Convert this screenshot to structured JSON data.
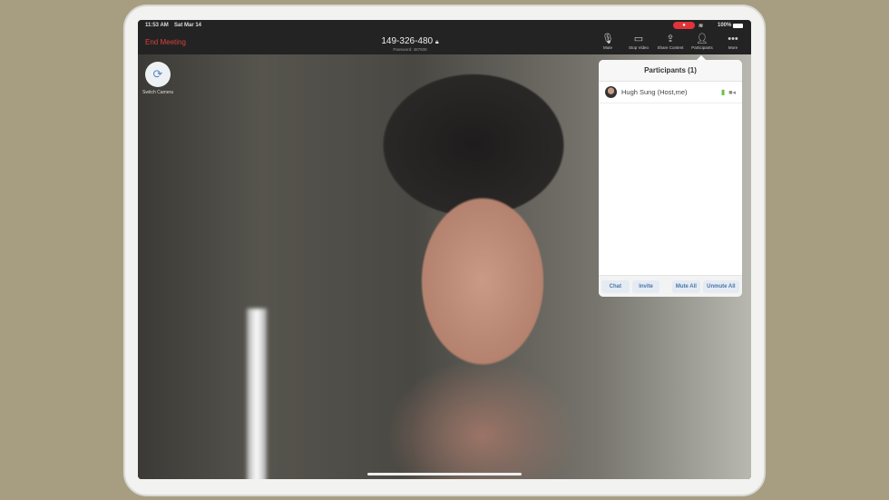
{
  "status": {
    "time": "11:53 AM",
    "date": "Sat Mar 14",
    "battery": "100%"
  },
  "meeting": {
    "end_label": "End Meeting",
    "id": "149-326-480",
    "password": "Password: 487930"
  },
  "toolbar": [
    {
      "label": "Mute",
      "icon": "mic-icon"
    },
    {
      "label": "Stop Video",
      "icon": "video-icon"
    },
    {
      "label": "Share Content",
      "icon": "share-icon"
    },
    {
      "label": "Participants",
      "icon": "participants-icon"
    },
    {
      "label": "More",
      "icon": "more-icon"
    }
  ],
  "switch_camera": "Switch Camera",
  "participants": {
    "title": "Participants (1)",
    "list": [
      {
        "name": "Hugh Sung (Host,me)"
      }
    ],
    "buttons": [
      "Chat",
      "Invite",
      "Mute All",
      "Unmute All"
    ]
  },
  "colors": {
    "end": "#d8413b",
    "accent": "#4a75a8",
    "mic_active": "#66c245"
  }
}
